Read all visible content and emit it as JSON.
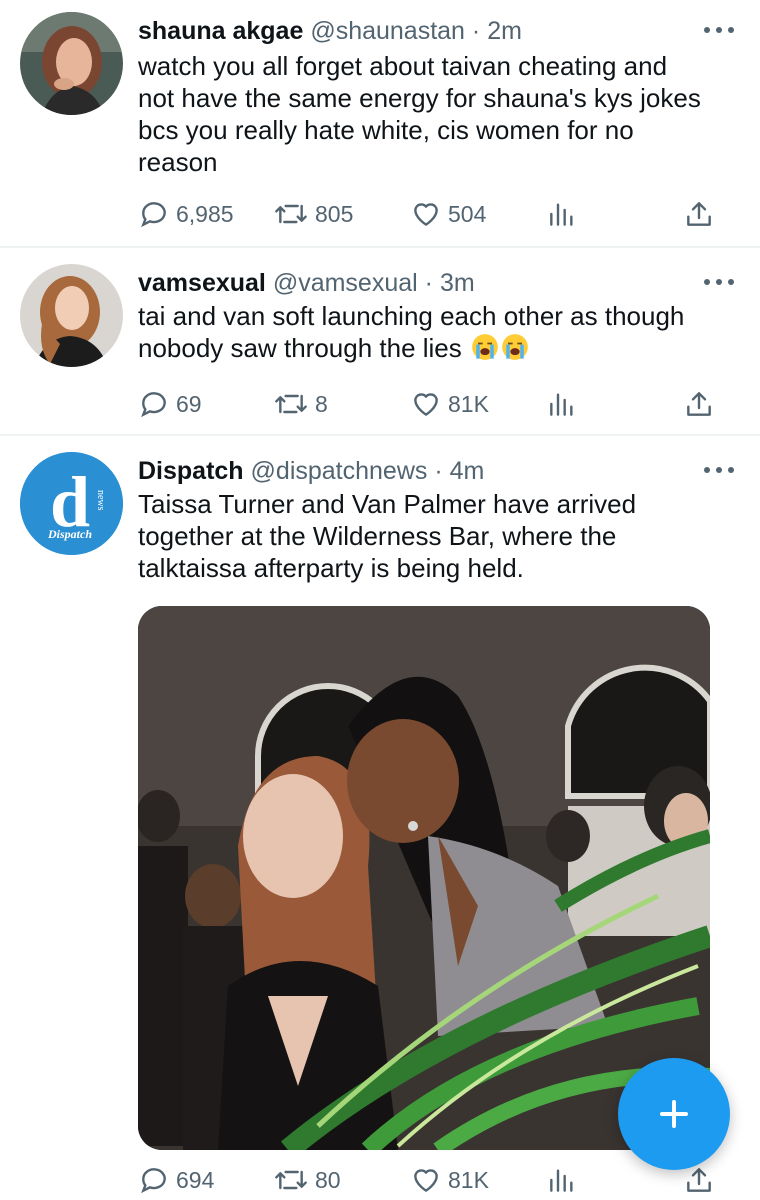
{
  "feed": {
    "tweets": [
      {
        "name": "shauna akgae",
        "handle": "@shaunastan",
        "separator": "·",
        "time": "2m",
        "text_lines": [
          "watch you all forget about taivan cheating and",
          "not have the same energy for shauna's kys jokes",
          "bcs you really hate white, cis women for no",
          "reason"
        ],
        "replies": "6,985",
        "retweets": "805",
        "likes": "504"
      },
      {
        "name": "vamsexual",
        "handle": "@vamsexual",
        "separator": "·",
        "time": "3m",
        "text_lines": [
          "tai and van soft launching each other as though",
          "nobody saw through the lies"
        ],
        "emoji": [
          "loudly-crying-face",
          "loudly-crying-face"
        ],
        "replies": "69",
        "retweets": "8",
        "likes": "81K"
      },
      {
        "name": "Dispatch",
        "handle": "@dispatchnews",
        "separator": "·",
        "time": "4m",
        "avatar_logo": {
          "letter": "d",
          "side_text": "news",
          "caption": "Dispatch"
        },
        "text_lines": [
          "Taissa Turner and Van Palmer have arrived",
          "together at the Wilderness Bar, where the",
          "talktaissa afterparty is being held."
        ],
        "replies": "694",
        "retweets": "80",
        "likes": "81K"
      }
    ]
  },
  "icons": {
    "reply": "reply-icon",
    "retweet": "retweet-icon",
    "like": "heart-icon",
    "stats": "analytics-icon",
    "share": "share-icon",
    "more": "more-icon",
    "compose": "plus-icon"
  },
  "colors": {
    "accent": "#1d9bf0",
    "secondary_text": "#536471",
    "primary_text": "#0f1419",
    "divider": "#eff3f4",
    "dispatch_blue": "#2a8fd3"
  }
}
